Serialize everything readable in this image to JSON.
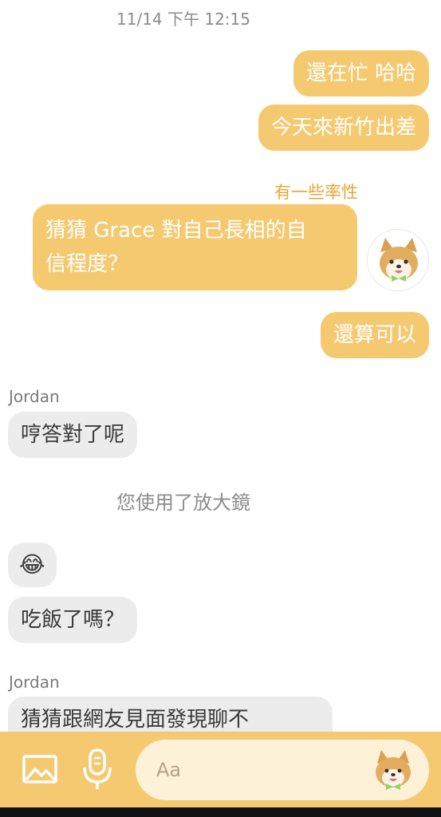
{
  "conversation": {
    "timestamp": "11/14 下午 12:15",
    "messages": [
      {
        "id": "m1",
        "type": "outgoing",
        "text": "還在忙 哈哈"
      },
      {
        "id": "m2",
        "type": "outgoing",
        "text": "今天來新竹出差"
      },
      {
        "id": "m3",
        "type": "question_label",
        "text": "有一些率性"
      },
      {
        "id": "m4",
        "type": "outgoing_question",
        "lines": [
          "猜猜 Grace 對自己長相的自",
          "信程度？"
        ]
      },
      {
        "id": "m5",
        "type": "outgoing",
        "text": "還算可以"
      },
      {
        "id": "m6",
        "type": "sender",
        "text": "Jordan"
      },
      {
        "id": "m7",
        "type": "incoming",
        "text": "哼答對了呢"
      },
      {
        "id": "m8",
        "type": "system",
        "text": "您使用了放大鏡"
      },
      {
        "id": "m9",
        "type": "incoming_emoji",
        "text": "😂"
      },
      {
        "id": "m10",
        "type": "incoming",
        "text": "吃飯了嗎？"
      },
      {
        "id": "m11",
        "type": "sender",
        "text": "Jordan"
      },
      {
        "id": "m12",
        "type": "incoming",
        "text": "猜猜跟網友見面發現聊不"
      }
    ]
  },
  "composer": {
    "placeholder": "Aa",
    "icons": [
      "image-icon",
      "microphone-icon",
      "shiba-sticker-icon"
    ]
  },
  "theme": {
    "accent": "#f5c970",
    "accent_text": "#e6a73a",
    "incoming_bg": "#ececec",
    "input_bg": "#fdf1d8"
  }
}
